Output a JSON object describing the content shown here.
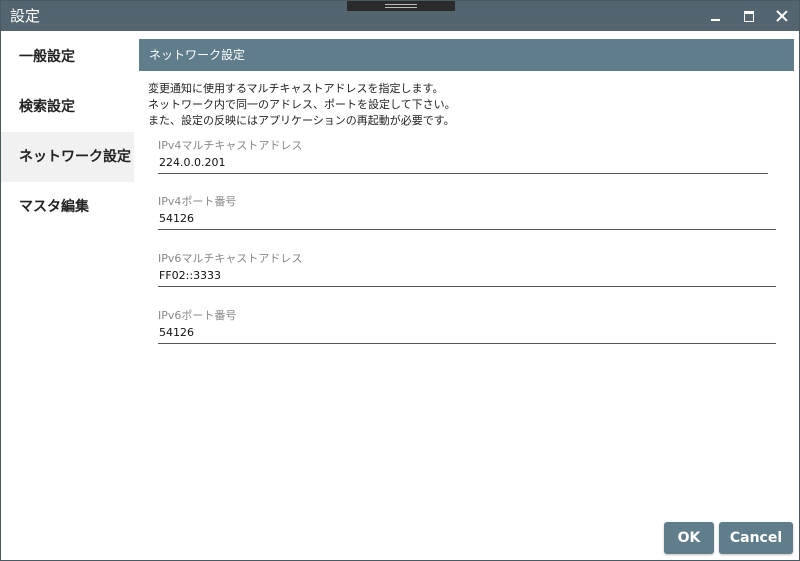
{
  "window": {
    "title": "設定"
  },
  "sidebar": {
    "items": [
      {
        "label": "一般設定",
        "active": false
      },
      {
        "label": "検索設定",
        "active": false
      },
      {
        "label": "ネットワーク設定",
        "active": true
      },
      {
        "label": "マスタ編集",
        "active": false
      }
    ]
  },
  "section": {
    "title": "ネットワーク設定",
    "description": [
      "変更通知に使用するマルチキャストアドレスを指定します。",
      "ネットワーク内で同一のアドレス、ポートを設定して下さい。",
      "また、設定の反映にはアプリケーションの再起動が必要です。"
    ]
  },
  "fields": [
    {
      "label": "IPv4マルチキャストアドレス",
      "value": "224.0.0.201"
    },
    {
      "label": "IPv4ポート番号",
      "value": "54126"
    },
    {
      "label": "IPv6マルチキャストアドレス",
      "value": "FF02::3333"
    },
    {
      "label": "IPv6ポート番号",
      "value": "54126"
    }
  ],
  "buttons": {
    "ok": "OK",
    "cancel": "Cancel"
  },
  "colors": {
    "titlebar": "#536570",
    "accent": "#607d8b",
    "active_nav": "#f1f1f1"
  },
  "icons": {
    "minimize": "minimize-icon",
    "maximize": "maximize-icon",
    "close": "close-icon"
  }
}
